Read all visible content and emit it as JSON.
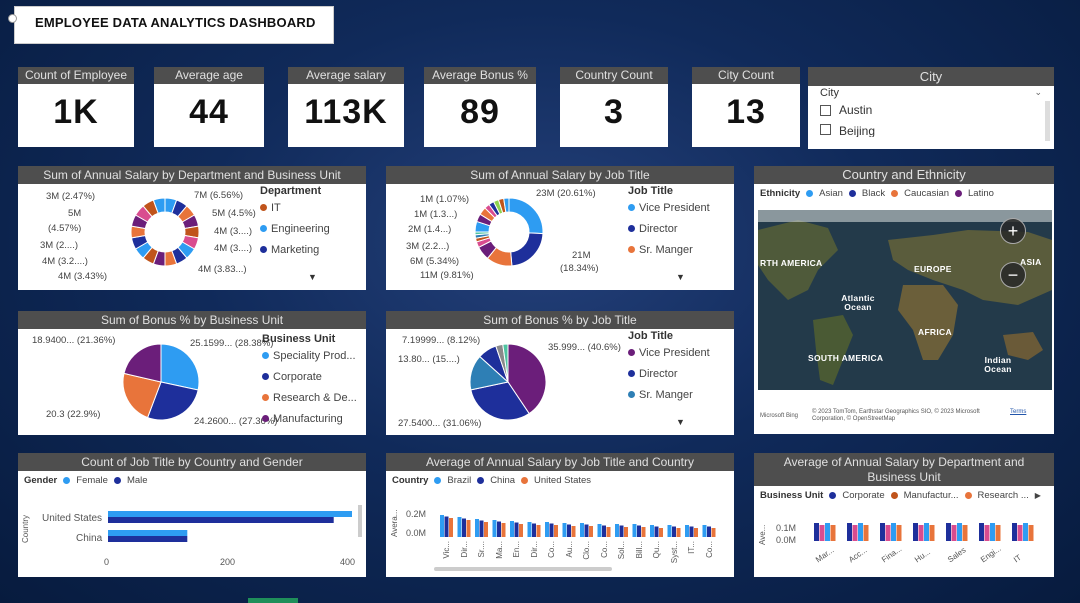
{
  "dashboard": {
    "title": "EMPLOYEE DATA ANALYTICS DASHBOARD"
  },
  "kpis": [
    {
      "label": "Count of Employee",
      "value": "1K"
    },
    {
      "label": "Average age",
      "value": "44"
    },
    {
      "label": "Average salary",
      "value": "113K"
    },
    {
      "label": "Average Bonus %",
      "value": "89"
    },
    {
      "label": "Country Count",
      "value": "3"
    },
    {
      "label": "City Count",
      "value": "13"
    }
  ],
  "city_slicer": {
    "title": "City",
    "header": "City",
    "options": [
      "Austin",
      "Beijing"
    ]
  },
  "salary_dept_bu": {
    "title": "Sum of Annual Salary by Department and Business Unit",
    "legend_title": "Department",
    "legend": [
      "IT",
      "Engineering",
      "Marketing"
    ],
    "labels": [
      "3M (2.47%)",
      "5M",
      "(4.57%)",
      "3M (2....)",
      "4M (3.2....)",
      "4M (3.43%)",
      "7M (6.56%)",
      "5M (4.5%)",
      "4M (3....)",
      "4M (3....)",
      "4M (3.83...)"
    ],
    "colors": {
      "IT": "#c0541b",
      "Engineering": "#2e9cf2",
      "Marketing": "#1e2f9b"
    }
  },
  "salary_job": {
    "title": "Sum of Annual Salary by Job Title",
    "legend_title": "Job Title",
    "legend": [
      "Vice President",
      "Director",
      "Sr. Manger"
    ],
    "labels": [
      "1M (1.07%)",
      "1M (1.3...)",
      "2M (1.4...)",
      "3M (2.2...)",
      "6M (5.34%)",
      "11M (9.81%)",
      "23M (20.61%)",
      "21M",
      "(18.34%)"
    ]
  },
  "country_ethnicity": {
    "title": "Country and Ethnicity",
    "legend_title": "Ethnicity",
    "legend": [
      "Asian",
      "Black",
      "Caucasian",
      "Latino"
    ],
    "colors": [
      "#2e9cf2",
      "#1e2f9b",
      "#e8743b",
      "#6b1e7a"
    ],
    "regions": [
      "RTH AMERICA",
      "EUROPE",
      "ASIA",
      "Atlantic Ocean",
      "AFRICA",
      "SOUTH AMERICA",
      "Indian Ocean"
    ],
    "attribution": "© 2023 TomTom, Earthstar Geographics SIO, © 2023 Microsoft Corporation, © OpenStreetMap",
    "terms": "Terms",
    "brand": "Microsoft Bing"
  },
  "bonus_bu": {
    "title": "Sum of Bonus % by Business Unit",
    "legend_title": "Business Unit",
    "legend": [
      "Speciality Prod...",
      "Corporate",
      "Research & De...",
      "Manufacturing"
    ],
    "labels": [
      "18.9400... (21.36%)",
      "25.1599... (28.38%)",
      "20.3 (22.9%)",
      "24.2600... (27.36%)"
    ],
    "chart_data": {
      "type": "pie",
      "categories": [
        "Speciality Prod...",
        "Corporate",
        "Research & De...",
        "Manufacturing"
      ],
      "values": [
        25.16,
        24.26,
        20.3,
        18.94
      ]
    }
  },
  "bonus_job": {
    "title": "Sum of Bonus % by Job Title",
    "legend_title": "Job Title",
    "legend": [
      "Vice President",
      "Director",
      "Sr. Manger"
    ],
    "labels": [
      "7.19999... (8.12%)",
      "13.80... (15....)",
      "35.999... (40.6%)",
      "27.5400... (31.06%)"
    ]
  },
  "job_country_gender": {
    "title": "Count of Job Title by Country and Gender",
    "legend_title": "Gender",
    "legend": [
      "Female",
      "Male"
    ],
    "categories": [
      "United States",
      "China"
    ],
    "axis_title": "Country",
    "ticks": [
      "0",
      "200",
      "400"
    ],
    "chart_data": {
      "type": "bar",
      "categories": [
        "United States",
        "China"
      ],
      "series": [
        {
          "name": "Female",
          "values": [
            400,
            130
          ]
        },
        {
          "name": "Male",
          "values": [
            370,
            130
          ]
        }
      ],
      "xlim": [
        0,
        400
      ]
    }
  },
  "salary_job_country": {
    "title": "Average of Annual Salary by Job Title and Country",
    "legend_title": "Country",
    "legend": [
      "Brazil",
      "China",
      "United States"
    ],
    "axis_title": "Avera...",
    "yticks": [
      "0.2M",
      "0.0M"
    ],
    "categories": [
      "Vic...",
      "Dir...",
      "Sr....",
      "Ma...",
      "En...",
      "Dir...",
      "Co...",
      "Au...",
      "Clo...",
      "Co...",
      "Sol...",
      "Bill...",
      "Qu...",
      "Syst...",
      "IT...",
      "Co..."
    ]
  },
  "salary_dept_bu2": {
    "title": "Average of Annual Salary by Department and Business Unit",
    "legend_title": "Business Unit",
    "legend": [
      "Corporate",
      "Manufactur...",
      "Research ..."
    ],
    "axis_title": "Ave...",
    "yticks": [
      "0.1M",
      "0.0M"
    ],
    "categories": [
      "Mar...",
      "Acc...",
      "Fina...",
      "Hu...",
      "Sales",
      "Engi...",
      "IT"
    ]
  },
  "colors": {
    "blue": "#2e9cf2",
    "navy": "#1e2f9b",
    "orange": "#e8743b",
    "purple": "#6b1e7a",
    "header": "#4e4e4e"
  }
}
